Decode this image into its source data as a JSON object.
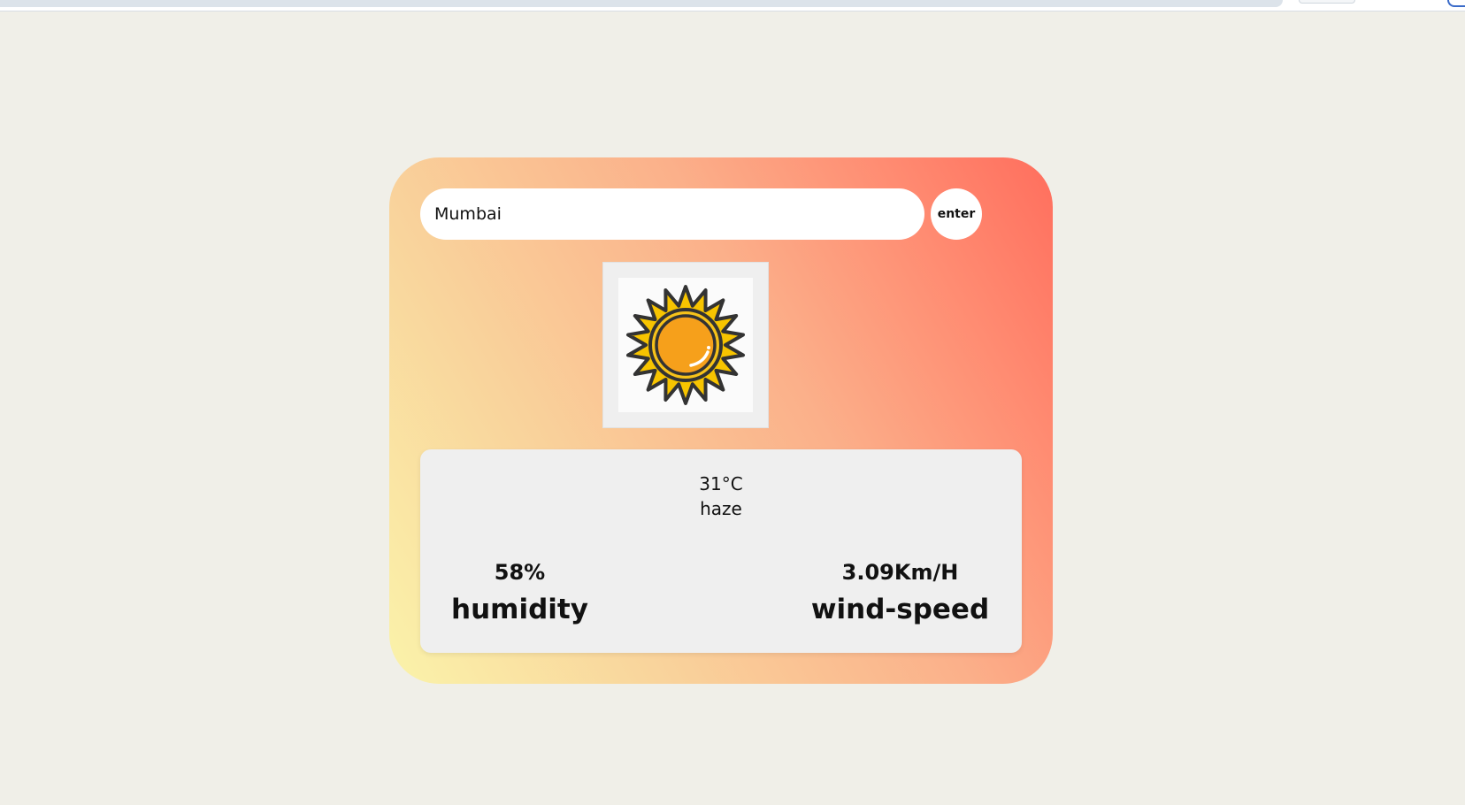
{
  "search": {
    "value": "Mumbai",
    "button_label": "enter"
  },
  "weather": {
    "icon": "sun-icon",
    "temperature": "31°C",
    "condition": "haze",
    "humidity": {
      "value": "58%",
      "label": "humidity"
    },
    "wind": {
      "value": "3.09Km/H",
      "label": "wind-speed"
    }
  },
  "colors": {
    "page_background": "#f0efe8",
    "card_gradient": [
      "#faf3aa",
      "#f9d29b",
      "#fbb08a",
      "#ff8c72",
      "#ff6e5d"
    ],
    "panel_background": "#efefef",
    "sun_ray": "#f7c400",
    "sun_core": "#f6a01b",
    "outline": "#333333"
  }
}
